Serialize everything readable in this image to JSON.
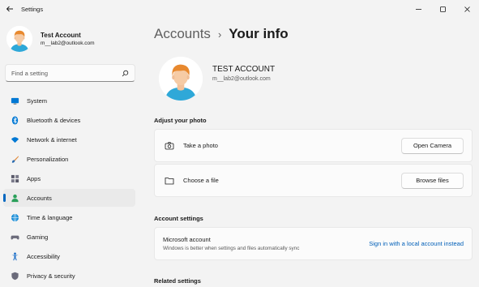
{
  "window": {
    "title": "Settings"
  },
  "profile": {
    "name": "Test Account",
    "email": "m__lab2@outlook.com"
  },
  "search": {
    "placeholder": "Find a setting"
  },
  "sidebar": {
    "items": [
      {
        "label": "System",
        "icon": "monitor-icon"
      },
      {
        "label": "Bluetooth & devices",
        "icon": "bluetooth-icon"
      },
      {
        "label": "Network & internet",
        "icon": "wifi-icon"
      },
      {
        "label": "Personalization",
        "icon": "brush-icon"
      },
      {
        "label": "Apps",
        "icon": "apps-icon"
      },
      {
        "label": "Accounts",
        "icon": "person-icon",
        "active": true
      },
      {
        "label": "Time & language",
        "icon": "globe-clock-icon"
      },
      {
        "label": "Gaming",
        "icon": "gamepad-icon"
      },
      {
        "label": "Accessibility",
        "icon": "accessibility-icon"
      },
      {
        "label": "Privacy & security",
        "icon": "shield-icon"
      }
    ]
  },
  "breadcrumb": {
    "parent": "Accounts",
    "separator": "›",
    "current": "Your info"
  },
  "user": {
    "name": "TEST ACCOUNT",
    "email": "m__lab2@outlook.com"
  },
  "photo": {
    "heading": "Adjust your photo",
    "take_photo_label": "Take a photo",
    "open_camera_label": "Open Camera",
    "choose_file_label": "Choose a file",
    "browse_files_label": "Browse files"
  },
  "account_settings": {
    "heading": "Account settings",
    "microsoft_account_title": "Microsoft account",
    "microsoft_account_desc": "Windows is better when settings and files automatically sync",
    "sign_in_local_link": "Sign in with a local account instead"
  },
  "related": {
    "heading": "Related settings"
  },
  "colors": {
    "accent": "#0067c0",
    "link": "#005fb8",
    "background": "#f3f3f3",
    "card": "#fbfbfb"
  }
}
